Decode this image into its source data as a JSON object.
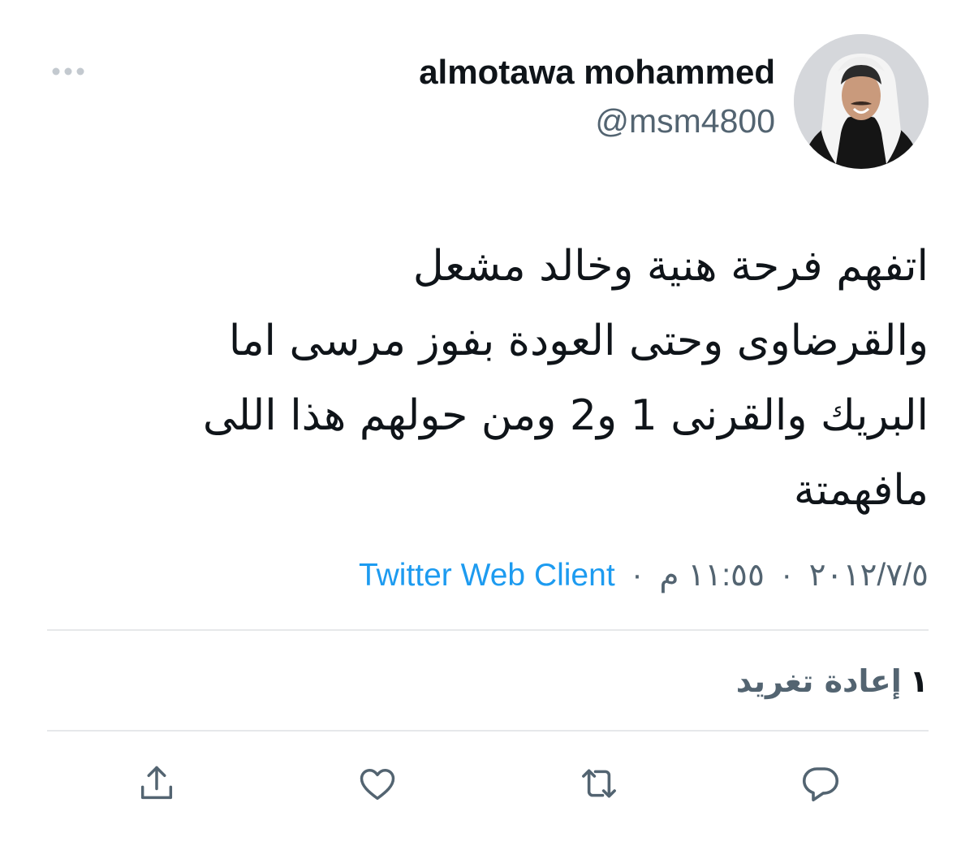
{
  "author": {
    "display_name": "almotawa mohammed",
    "handle": "@msm4800"
  },
  "tweet": {
    "lines": [
      "اتفهم فرحة هنية وخالد مشعل",
      "والقرضاوى وحتى العودة بفوز مرسى اما",
      "البريك والقرنى 1 و2 ومن حولهم هذا اللى",
      "مافهمتة"
    ]
  },
  "meta": {
    "date": "٢٠١٢/٧/٥",
    "separator": "·",
    "time": "١١:٥٥ م",
    "client": "Twitter Web Client"
  },
  "stats": {
    "retweet_count": "١",
    "retweet_label": "إعادة تغريد"
  },
  "icons": {
    "more": "more-horizontal-icon",
    "share": "share-icon",
    "like": "heart-icon",
    "retweet": "retweet-icon",
    "reply": "reply-icon"
  },
  "colors": {
    "text_primary": "#0f1419",
    "text_secondary": "#536471",
    "accent": "#1d9bf0",
    "icon": "#536471",
    "divider": "#e6e8ea"
  }
}
